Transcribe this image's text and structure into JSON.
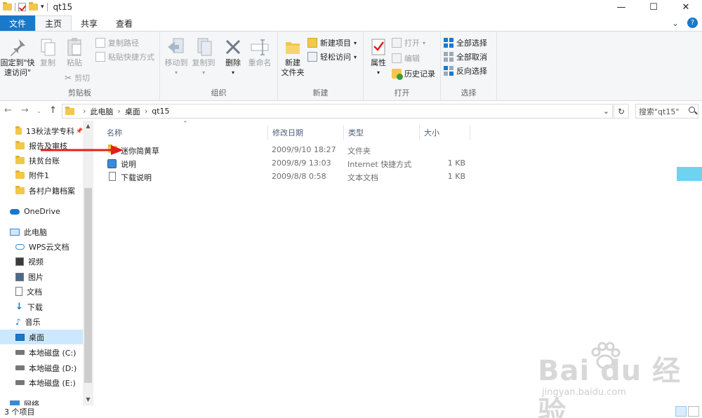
{
  "window": {
    "title": "qt15",
    "minimize": "—",
    "maximize": "☐",
    "close": "✕"
  },
  "tabs": {
    "file": "文件",
    "home": "主页",
    "share": "共享",
    "view": "查看"
  },
  "ribbon": {
    "clipboard": {
      "label": "剪贴板",
      "pin": "固定到\"快速访问\"",
      "copy": "复制",
      "paste": "粘贴",
      "copy_path": "复制路径",
      "paste_shortcut": "粘贴快捷方式",
      "cut": "剪切"
    },
    "organize": {
      "label": "组织",
      "move_to": "移动到",
      "copy_to": "复制到",
      "delete": "删除",
      "rename": "重命名"
    },
    "new": {
      "label": "新建",
      "new_folder": "新建\n文件夹",
      "new_item": "新建项目",
      "easy_access": "轻松访问"
    },
    "open": {
      "label": "打开",
      "properties": "属性",
      "open": "打开",
      "edit": "编辑",
      "history": "历史记录"
    },
    "select": {
      "label": "选择",
      "select_all": "全部选择",
      "select_none": "全部取消",
      "invert": "反向选择"
    }
  },
  "address": {
    "crumbs": [
      "此电脑",
      "桌面",
      "qt15"
    ],
    "search_placeholder": "搜索\"qt15\""
  },
  "nav": {
    "quick": [
      "13秋法学专科",
      "报告及审核",
      "扶贫台账",
      "附件1",
      "各村户籍档案"
    ],
    "onedrive": "OneDrive",
    "this_pc": "此电脑",
    "pc_items": [
      "WPS云文档",
      "视频",
      "图片",
      "文档",
      "下载",
      "音乐",
      "桌面",
      "本地磁盘 (C:)",
      "本地磁盘 (D:)",
      "本地磁盘 (E:)"
    ],
    "network": "网络"
  },
  "columns": {
    "name": "名称",
    "date": "修改日期",
    "type": "类型",
    "size": "大小"
  },
  "files": [
    {
      "name": "迷你简黄草",
      "date": "2009/9/10 18:27",
      "type": "文件夹",
      "size": ""
    },
    {
      "name": "说明",
      "date": "2009/8/9 13:03",
      "type": "Internet 快捷方式",
      "size": "1 KB"
    },
    {
      "name": "下载说明",
      "date": "2009/8/8 0:58",
      "type": "文本文档",
      "size": "1 KB"
    }
  ],
  "status": {
    "count": "3 个项目"
  },
  "watermark": {
    "main": "Bai du 经验",
    "sub": "jingyan.baidu.com"
  },
  "colors": {
    "file_tab": "#1979ca",
    "selection": "#cce8ff",
    "arrow": "#e02020",
    "folder": "#f3c74b"
  }
}
